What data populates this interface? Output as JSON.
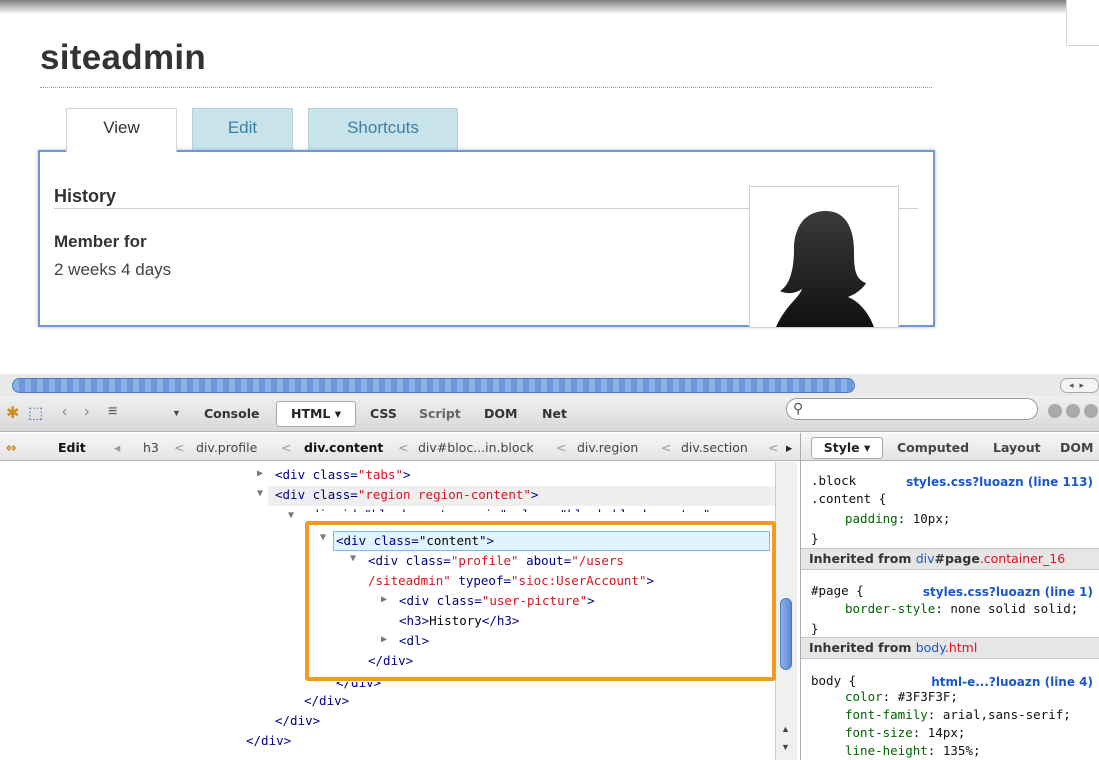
{
  "page": {
    "title": "siteadmin",
    "tabs": [
      {
        "label": "View",
        "active": true
      },
      {
        "label": "Edit",
        "active": false
      },
      {
        "label": "Shortcuts",
        "active": false
      }
    ],
    "history_heading": "History",
    "member_label": "Member for",
    "member_value": "2 weeks 4 days"
  },
  "firebug": {
    "toolbar": {
      "console": "Console",
      "html": "HTML ▾",
      "css": "CSS",
      "script": "Script",
      "dom": "DOM",
      "net": "Net"
    },
    "breadcrumbs": {
      "edit": "Edit",
      "items": [
        "h3",
        "div.profile",
        "div.content",
        "div#bloc...in.block",
        "div.region",
        "div.section"
      ]
    },
    "html_lines": {
      "l0a": "<div ",
      "l0b": "class",
      "l0c": "=",
      "l0d": "\"tabs\"",
      "l0e": ">",
      "l1a": "<div ",
      "l1b": "class",
      "l1c": "=",
      "l1d": "\"region region-content\"",
      "l1e": ">",
      "l2": "<div id=\"block-system-main\" class=\"block block-system\">",
      "l3a": "<div ",
      "l3b": "class",
      "l3c": "=",
      "l3d": "\"content\"",
      "l3e": ">",
      "l4a": "<div ",
      "l4b": "class",
      "l4c": "=",
      "l4d": "\"profile\"",
      "l4e": " about",
      "l4f": "=",
      "l4g": "\"/users",
      "l5a": "/siteadmin\"",
      "l5b": " typeof",
      "l5c": "=",
      "l5d": "\"sioc:UserAccount\"",
      "l5e": ">",
      "l6a": "<div ",
      "l6b": "class",
      "l6c": "=",
      "l6d": "\"user-picture\"",
      "l6e": ">",
      "l7a": "<h3>",
      "l7b": "History",
      "l7c": "</h3>",
      "l8": "<dl>",
      "l9": "</div>",
      "l10": "</div>",
      "l11": "</div>",
      "l12": "</div>",
      "l13": "</div>"
    },
    "side": {
      "tabs": {
        "style": "Style ▾",
        "computed": "Computed",
        "layout": "Layout",
        "dom": "DOM"
      },
      "rule1_sel1": ".block",
      "rule1_sel2": ".content {",
      "rule1_link": "styles.css?luoazn (line 113)",
      "rule1_prop": "padding",
      "rule1_val": ": 10px;",
      "close": "}",
      "inh1_prefix": "Inherited from ",
      "inh1_el": "div",
      "inh1_id": "#page",
      "inh1_cls": ".container_16",
      "rule2_sel": "#page {",
      "rule2_link": "styles.css?luoazn (line 1)",
      "rule2_prop": "border-style",
      "rule2_val": ": none solid solid;",
      "inh2_prefix": "Inherited from ",
      "inh2_el": "body",
      "inh2_cls": ".html",
      "rule3_sel": "body {",
      "rule3_link": "html-e...?luoazn (line 4)",
      "rule3_p1": "color",
      "rule3_v1": ": #3F3F3F;",
      "rule3_p2": "font-family",
      "rule3_v2": ": arial,sans-serif;",
      "rule3_p3": "font-size",
      "rule3_v3": ": 14px;",
      "rule3_p4": "line-height",
      "rule3_v4": ": 135%;"
    }
  }
}
